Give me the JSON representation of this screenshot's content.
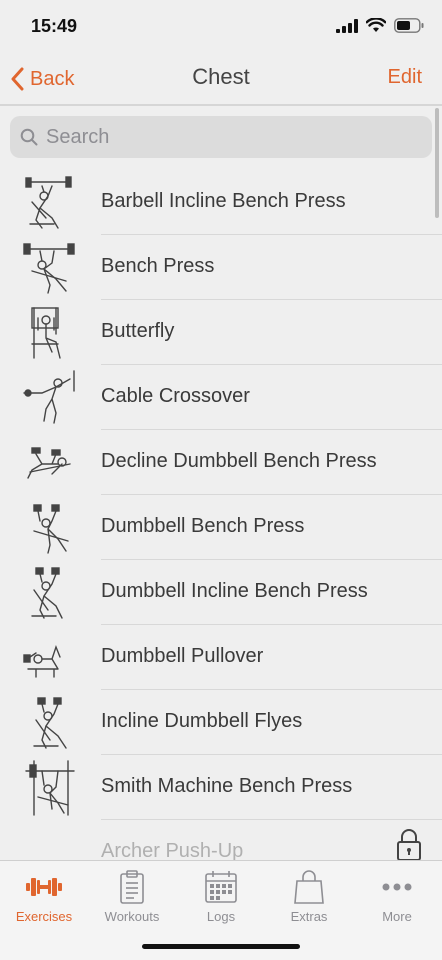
{
  "status": {
    "time": "15:49"
  },
  "nav": {
    "back_label": "Back",
    "title": "Chest",
    "edit_label": "Edit"
  },
  "search": {
    "placeholder": "Search"
  },
  "exercises": [
    {
      "label": "Barbell Incline Bench Press",
      "icon": "barbell-incline-figure"
    },
    {
      "label": "Bench Press",
      "icon": "barbell-bench-figure"
    },
    {
      "label": "Butterfly",
      "icon": "butterfly-machine-figure"
    },
    {
      "label": "Cable Crossover",
      "icon": "cable-crossover-figure"
    },
    {
      "label": "Decline Dumbbell Bench Press",
      "icon": "decline-dumbbell-figure"
    },
    {
      "label": "Dumbbell Bench Press",
      "icon": "dumbbell-bench-figure"
    },
    {
      "label": "Dumbbell Incline Bench Press",
      "icon": "dumbbell-incline-figure"
    },
    {
      "label": "Dumbbell Pullover",
      "icon": "dumbbell-pullover-figure"
    },
    {
      "label": "Incline Dumbbell Flyes",
      "icon": "incline-flyes-figure"
    },
    {
      "label": "Smith Machine Bench Press",
      "icon": "smith-machine-figure"
    },
    {
      "label": "Archer Push-Up",
      "icon": "pushup-figure",
      "locked": true
    }
  ],
  "tabs": [
    {
      "label": "Exercises",
      "icon": "dumbbell-icon",
      "active": true
    },
    {
      "label": "Workouts",
      "icon": "clipboard-icon"
    },
    {
      "label": "Logs",
      "icon": "calendar-icon"
    },
    {
      "label": "Extras",
      "icon": "shopping-bag-icon"
    },
    {
      "label": "More",
      "icon": "more-dots-icon"
    }
  ],
  "colors": {
    "accent": "#e0662f",
    "background": "#efefef",
    "inactive": "#8e8e93"
  }
}
